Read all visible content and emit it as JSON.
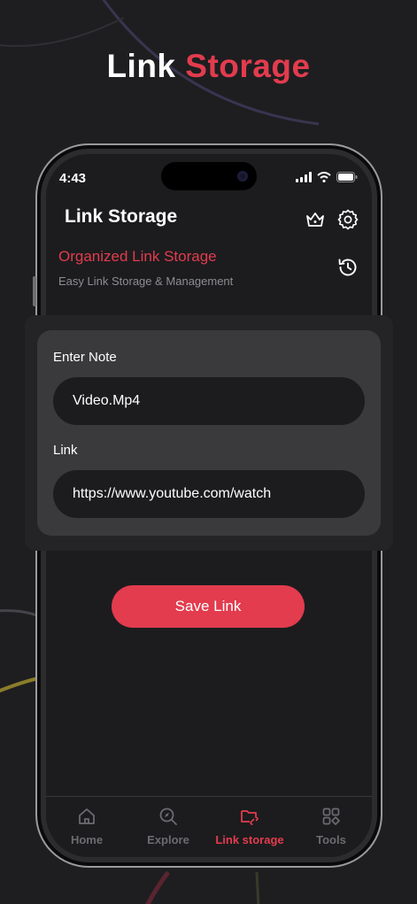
{
  "headline": {
    "word1": "Link",
    "word2": "Storage"
  },
  "status_bar": {
    "time": "4:43"
  },
  "header": {
    "title": "Link Storage",
    "tagline": "Organized Link Storage",
    "description": "Easy Link Storage & Management",
    "icons": [
      "crown-icon",
      "gear-icon",
      "history-icon"
    ]
  },
  "form": {
    "note_label": "Enter Note",
    "note_value": "Video.Mp4",
    "link_label": "Link",
    "link_value": "https://www.youtube.com/watch",
    "save_label": "Save Link"
  },
  "tabs": [
    {
      "label": "Home",
      "icon": "home-icon",
      "active": false
    },
    {
      "label": "Explore",
      "icon": "explore-icon",
      "active": false
    },
    {
      "label": "Link storage",
      "icon": "link-folder-icon",
      "active": true
    },
    {
      "label": "Tools",
      "icon": "tools-grid-icon",
      "active": false
    }
  ],
  "colors": {
    "accent": "#e23c4e",
    "background": "#1e1e20",
    "card": "#3a3a3c",
    "field": "#1c1c1e"
  }
}
